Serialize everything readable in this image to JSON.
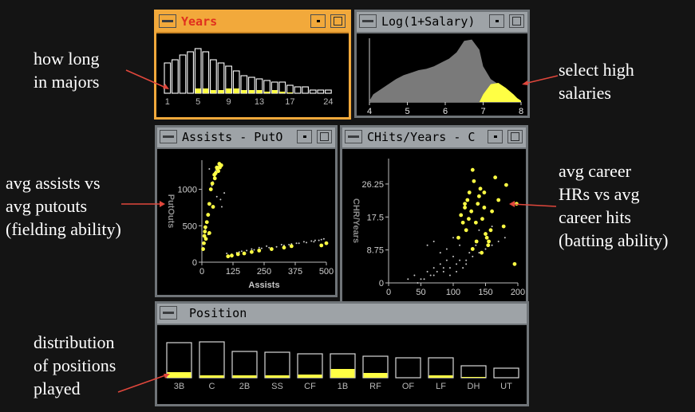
{
  "annotations": {
    "years_note": [
      "how long",
      "in majors"
    ],
    "salary_note": [
      "select high",
      "salaries"
    ],
    "fielding_note": [
      "avg assists vs",
      "avg putouts",
      "(fielding ability)"
    ],
    "batting_note": [
      "avg career",
      "HRs vs avg",
      "career hits",
      "(batting ability)"
    ],
    "position_note": [
      "distribution",
      "of positions",
      "played"
    ]
  },
  "windows": {
    "years": {
      "title": "Years"
    },
    "salary": {
      "title": "Log(1+Salary)"
    },
    "assists": {
      "title": "Assists  - PutO"
    },
    "chits": {
      "title": "CHits/Years  - C"
    },
    "position": {
      "title": "Position"
    }
  },
  "colors": {
    "highlight": "#ffff44",
    "active_border": "#f2a93b",
    "window_border": "#6f7478",
    "bar_outline": "#ffffff",
    "density_fill": "#7a7a7a"
  },
  "chart_data": [
    {
      "type": "bar",
      "id": "years",
      "tick_labels": [
        "1",
        "5",
        "9",
        "13",
        "17",
        "24"
      ],
      "series": [
        {
          "values": [
            38,
            42,
            48,
            52,
            56,
            52,
            42,
            38,
            34,
            28,
            22,
            20,
            18,
            16,
            14,
            14,
            10,
            8,
            8,
            4,
            4,
            4
          ]
        },
        {
          "values": [
            0,
            0,
            0,
            0,
            6,
            6,
            4,
            4,
            6,
            6,
            4,
            4,
            4,
            2,
            4,
            2,
            1,
            0,
            0,
            0,
            0,
            0
          ]
        }
      ]
    },
    {
      "type": "area",
      "id": "salary",
      "x_ticks": [
        "4",
        "5",
        "6",
        "7",
        "8"
      ],
      "xlim": [
        4,
        8
      ],
      "series": [
        {
          "x": [
            4.0,
            4.1,
            4.3,
            4.5,
            4.7,
            4.9,
            5.1,
            5.3,
            5.5,
            5.7,
            5.9,
            6.1,
            6.3,
            6.5,
            6.7,
            6.9,
            7.0,
            7.2,
            7.4,
            7.6,
            7.8,
            8.0
          ],
          "y": [
            0.02,
            0.12,
            0.2,
            0.28,
            0.36,
            0.42,
            0.46,
            0.5,
            0.52,
            0.56,
            0.62,
            0.68,
            0.78,
            0.96,
            0.98,
            0.82,
            0.56,
            0.36,
            0.28,
            0.2,
            0.1,
            0.02
          ]
        },
        {
          "x": [
            6.9,
            7.0,
            7.2,
            7.4,
            7.6,
            7.8,
            7.9,
            8.0
          ],
          "y": [
            0.0,
            0.12,
            0.28,
            0.3,
            0.22,
            0.12,
            0.06,
            0.02
          ]
        }
      ]
    },
    {
      "type": "scatter",
      "id": "assists",
      "xlabel": "Assists",
      "ylabel": "PutOuts",
      "x_ticks": [
        "0",
        "125",
        "250",
        "375",
        "500"
      ],
      "y_ticks": [
        "0",
        "500",
        "1000"
      ],
      "xlim": [
        0,
        500
      ],
      "ylim": [
        0,
        1400
      ],
      "series": [
        {
          "x": [
            30,
            52,
            44,
            68,
            55,
            60,
            40,
            80,
            120,
            150,
            180,
            210,
            240,
            270,
            300,
            330,
            360,
            390,
            420,
            450,
            470,
            490,
            15,
            20,
            25,
            100,
            160,
            200,
            260,
            320,
            380,
            440,
            480,
            75,
            90,
            140,
            230,
            350,
            410,
            455
          ],
          "y": [
            1280,
            1180,
            1100,
            1320,
            1250,
            900,
            1050,
            760,
            110,
            140,
            160,
            170,
            190,
            200,
            210,
            230,
            250,
            260,
            270,
            280,
            300,
            320,
            460,
            320,
            380,
            120,
            150,
            180,
            220,
            240,
            260,
            290,
            310,
            860,
            950,
            130,
            200,
            240,
            280,
            300
          ]
        },
        {
          "x": [
            5,
            8,
            10,
            12,
            14,
            16,
            20,
            25,
            30,
            36,
            42,
            50,
            52,
            55,
            60,
            62,
            66,
            70,
            72,
            78,
            30,
            45,
            105,
            120,
            145,
            170,
            200,
            230,
            280,
            330,
            360,
            480,
            500
          ],
          "y": [
            180,
            260,
            360,
            420,
            480,
            320,
            550,
            650,
            800,
            1000,
            1080,
            1200,
            1150,
            1220,
            1300,
            1280,
            1250,
            1350,
            1300,
            1330,
            400,
            760,
            80,
            90,
            110,
            120,
            140,
            160,
            180,
            200,
            220,
            230,
            260
          ]
        }
      ]
    },
    {
      "type": "scatter",
      "id": "chits",
      "xlabel": "CHits/Years",
      "ylabel": "CHR/Years",
      "x_ticks": [
        "0",
        "50",
        "100",
        "150",
        "200"
      ],
      "y_ticks": [
        "0",
        "8.75",
        "17.5",
        "26.25"
      ],
      "xlim": [
        0,
        200
      ],
      "ylim": [
        0,
        33
      ],
      "series": [
        {
          "x": [
            40,
            60,
            70,
            80,
            90,
            100,
            110,
            120,
            60,
            70,
            80,
            90,
            100,
            110,
            55,
            65,
            75,
            85,
            95,
            105,
            115,
            125,
            135,
            30,
            45,
            50,
            70,
            85,
            95,
            105,
            120,
            130,
            140,
            150,
            160,
            170,
            180,
            140,
            150,
            160
          ],
          "y": [
            2,
            3,
            4,
            5,
            6,
            7,
            6,
            5,
            10,
            11,
            8,
            9,
            12,
            10,
            1,
            2,
            3,
            4,
            2,
            3,
            4,
            8,
            10,
            1,
            0,
            1,
            2,
            3,
            4,
            5,
            6,
            7,
            8,
            9,
            10,
            11,
            12,
            14,
            13,
            15
          ]
        },
        {
          "x": [
            108,
            112,
            115,
            118,
            120,
            122,
            125,
            128,
            130,
            132,
            135,
            138,
            140,
            142,
            145,
            148,
            150,
            155,
            160,
            165,
            170,
            178,
            182,
            195,
            130,
            136,
            144,
            152,
            158,
            118,
            124,
            148,
            154,
            198
          ],
          "y": [
            12,
            18,
            16,
            20,
            14,
            22,
            24,
            19,
            30,
            27,
            16,
            21,
            23,
            25,
            17,
            20,
            13,
            11,
            19,
            28,
            22,
            15,
            26,
            5,
            9,
            11,
            8,
            12,
            14,
            21,
            17,
            24,
            10,
            21
          ]
        }
      ]
    },
    {
      "type": "bar",
      "id": "position",
      "categories": [
        "3B",
        "C",
        "2B",
        "SS",
        "CF",
        "1B",
        "RF",
        "OF",
        "LF",
        "DH",
        "UT"
      ],
      "series": [
        {
          "values": [
            44,
            45,
            33,
            32,
            30,
            30,
            27,
            25,
            25,
            15,
            12
          ]
        },
        {
          "values": [
            7,
            3,
            3,
            3,
            4,
            11,
            6,
            0,
            3,
            1,
            0
          ]
        }
      ]
    }
  ]
}
